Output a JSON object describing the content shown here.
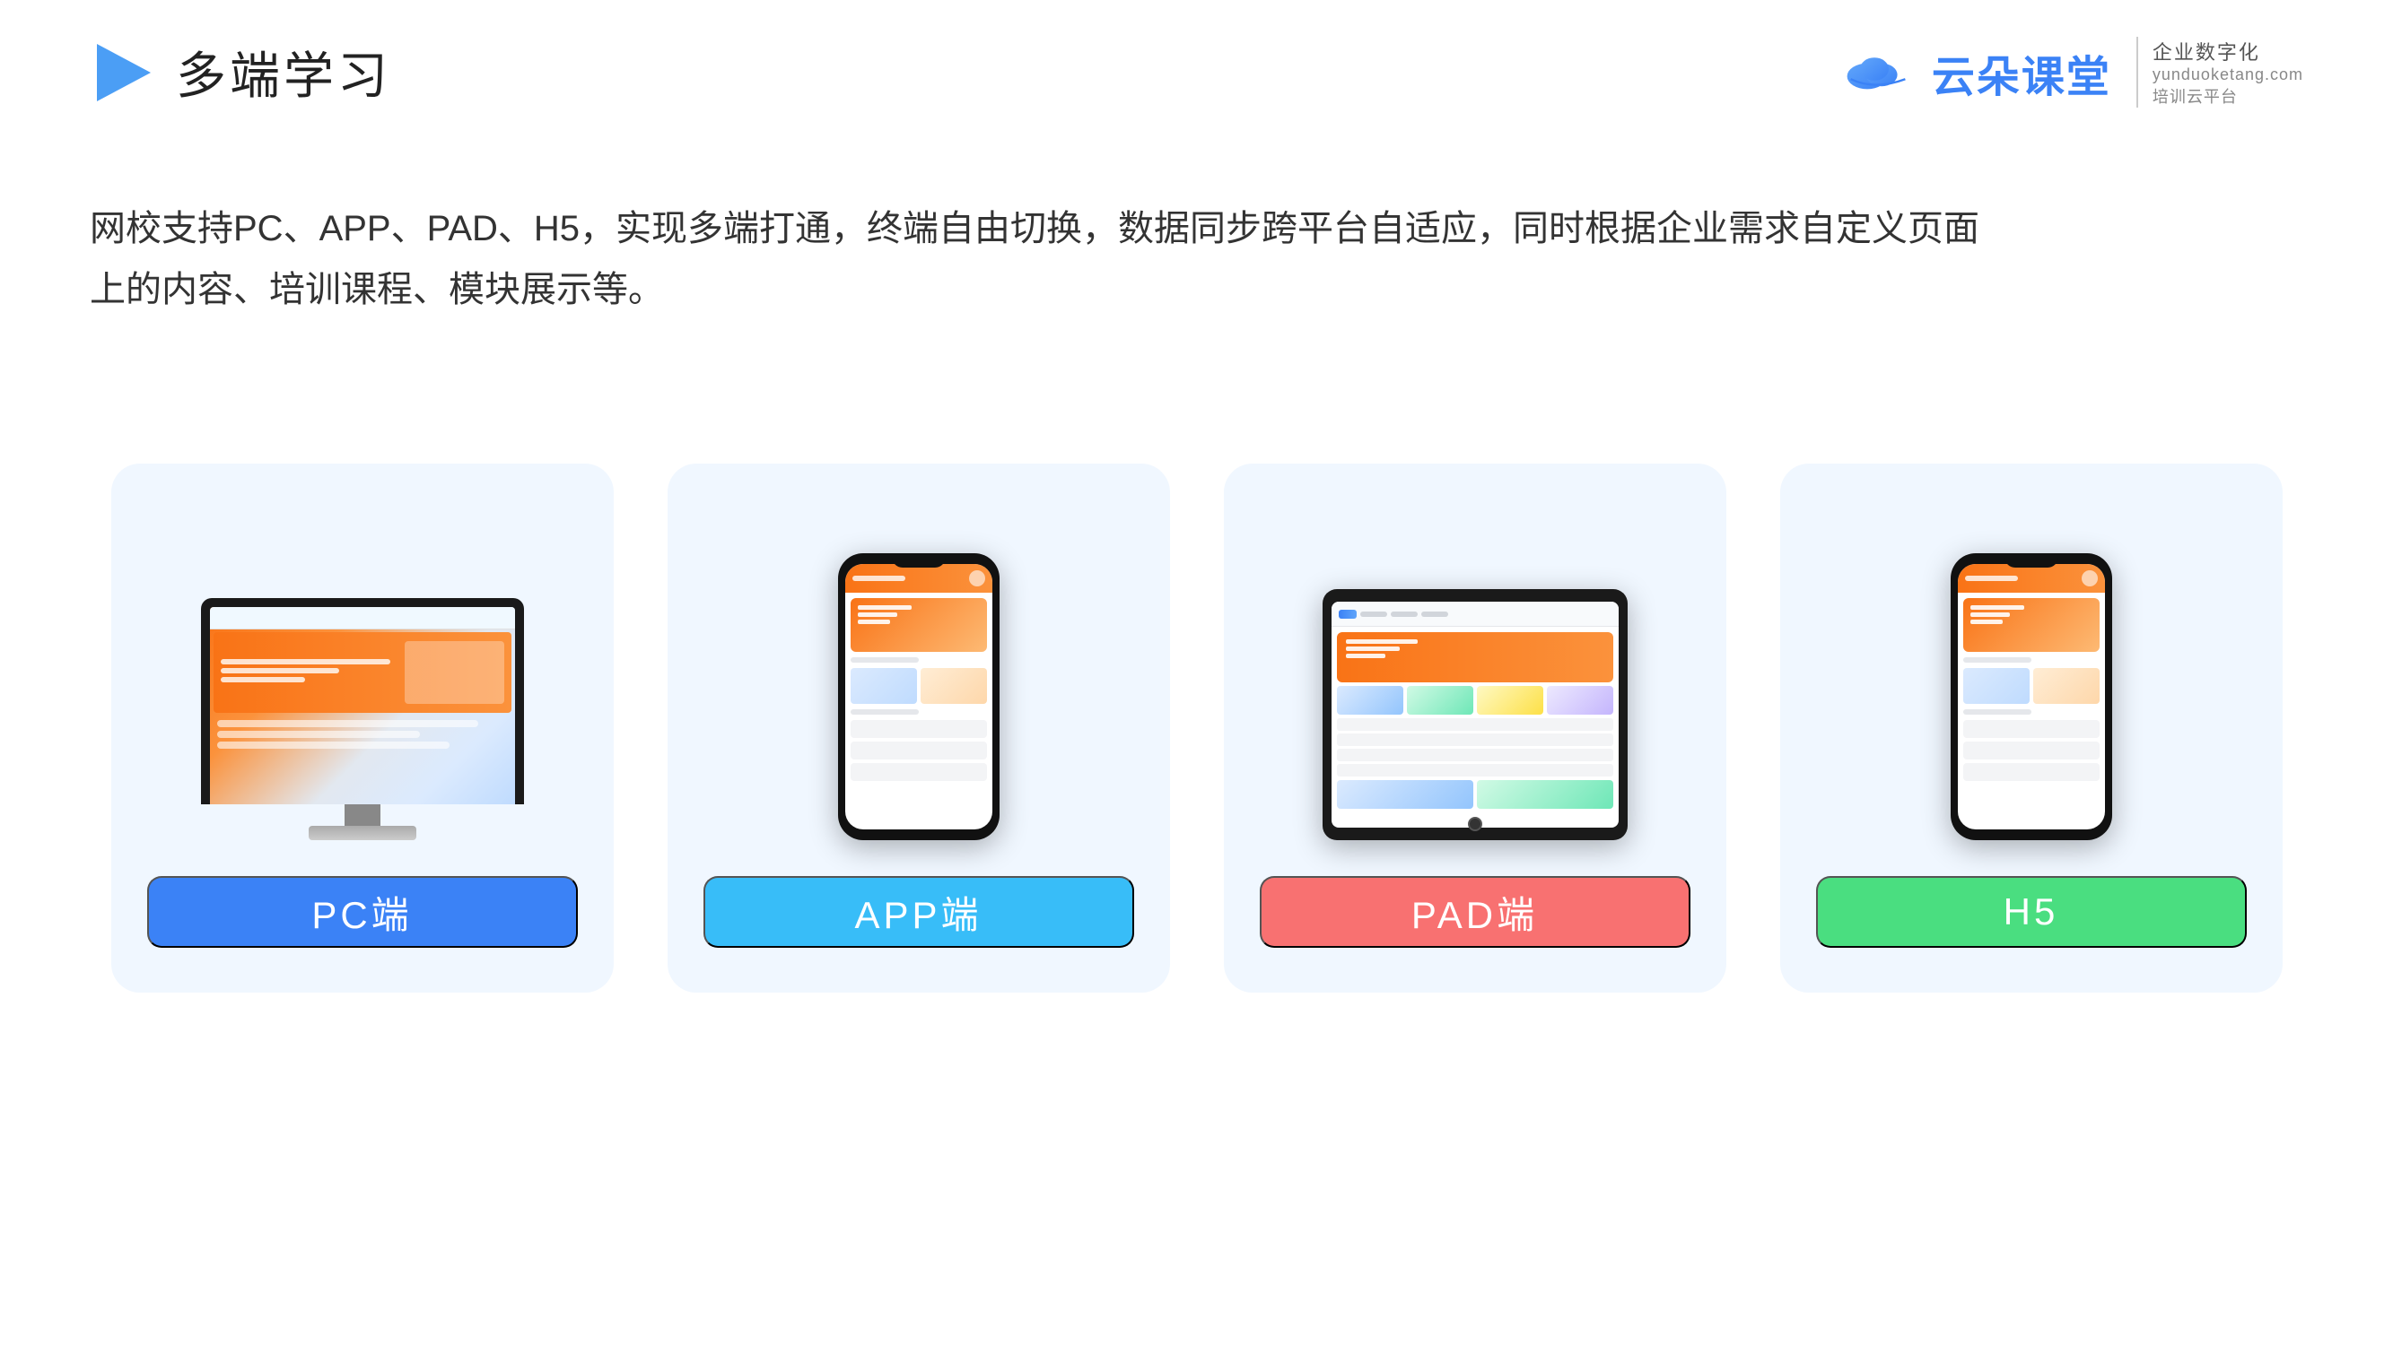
{
  "header": {
    "title": "多端学习",
    "logo_alt": "云朵课堂 yunduoketang.com 企业数字化 培训云平台",
    "company_name": "云朵课堂",
    "company_url": "yunduoketang.com",
    "company_tag1": "企业数字化",
    "company_tag2": "培训云平台"
  },
  "description": {
    "text_line1": "网校支持PC、APP、PAD、H5，实现多端打通，终端自由切换，数据同步跨平台自适应，同时根据企业需求自定义页面",
    "text_line2": "上的内容、培训课程、模块展示等。"
  },
  "cards": [
    {
      "id": "pc",
      "label": "PC端",
      "label_color": "blue",
      "device_type": "monitor"
    },
    {
      "id": "app",
      "label": "APP端",
      "label_color": "sky",
      "device_type": "phone"
    },
    {
      "id": "pad",
      "label": "PAD端",
      "label_color": "red",
      "device_type": "pad"
    },
    {
      "id": "h5",
      "label": "H5",
      "label_color": "green",
      "device_type": "phone2"
    }
  ]
}
